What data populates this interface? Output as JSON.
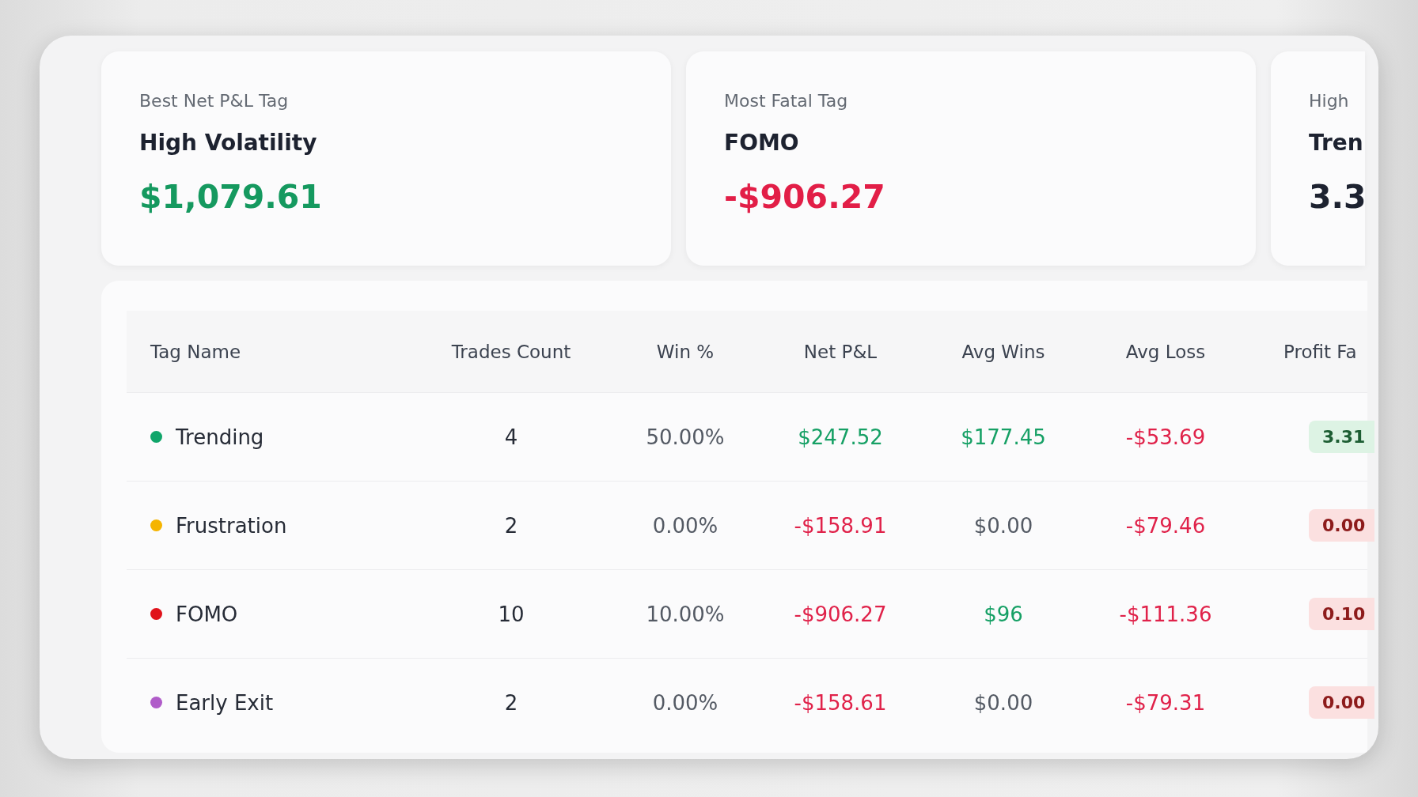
{
  "cards": [
    {
      "label": "Best Net P&L Tag",
      "title": "High Volatility",
      "value": "$1,079.61",
      "kind": "gain"
    },
    {
      "label": "Most Fatal Tag",
      "title": "FOMO",
      "value": "-$906.27",
      "kind": "loss"
    },
    {
      "label": "High",
      "title": "Tren",
      "value": "3.3",
      "kind": "plain"
    }
  ],
  "table": {
    "columns": [
      "Tag Name",
      "Trades Count",
      "Win %",
      "Net P&L",
      "Avg Wins",
      "Avg Loss",
      "Profit Fa"
    ],
    "rows": [
      {
        "cells": [
          {
            "text": "Trending",
            "kind": "tag",
            "color": "#10a56a"
          },
          {
            "text": "4",
            "kind": "plain"
          },
          {
            "text": "50.00%",
            "kind": "muted"
          },
          {
            "text": "$247.52",
            "kind": "gain"
          },
          {
            "text": "$177.45",
            "kind": "gain"
          },
          {
            "text": "-$53.69",
            "kind": "loss"
          },
          {
            "text": "3.31",
            "kind": "gainbadge"
          }
        ]
      },
      {
        "cells": [
          {
            "text": "Frustration",
            "kind": "tag",
            "color": "#f5b400"
          },
          {
            "text": "2",
            "kind": "plain"
          },
          {
            "text": "0.00%",
            "kind": "muted"
          },
          {
            "text": "-$158.91",
            "kind": "loss"
          },
          {
            "text": "$0.00",
            "kind": "muted"
          },
          {
            "text": "-$79.46",
            "kind": "loss"
          },
          {
            "text": "0.00",
            "kind": "lossbadge"
          }
        ]
      },
      {
        "cells": [
          {
            "text": "FOMO",
            "kind": "tag",
            "color": "#e0131b"
          },
          {
            "text": "10",
            "kind": "plain"
          },
          {
            "text": "10.00%",
            "kind": "muted"
          },
          {
            "text": "-$906.27",
            "kind": "loss"
          },
          {
            "text": "$96",
            "kind": "gain"
          },
          {
            "text": "-$111.36",
            "kind": "loss"
          },
          {
            "text": "0.10",
            "kind": "lossbadge"
          }
        ]
      },
      {
        "cells": [
          {
            "text": "Early Exit",
            "kind": "tag",
            "color": "#b05cc9"
          },
          {
            "text": "2",
            "kind": "plain"
          },
          {
            "text": "0.00%",
            "kind": "muted"
          },
          {
            "text": "-$158.61",
            "kind": "loss"
          },
          {
            "text": "$0.00",
            "kind": "muted"
          },
          {
            "text": "-$79.31",
            "kind": "loss"
          },
          {
            "text": "0.00",
            "kind": "lossbadge"
          }
        ]
      }
    ]
  }
}
